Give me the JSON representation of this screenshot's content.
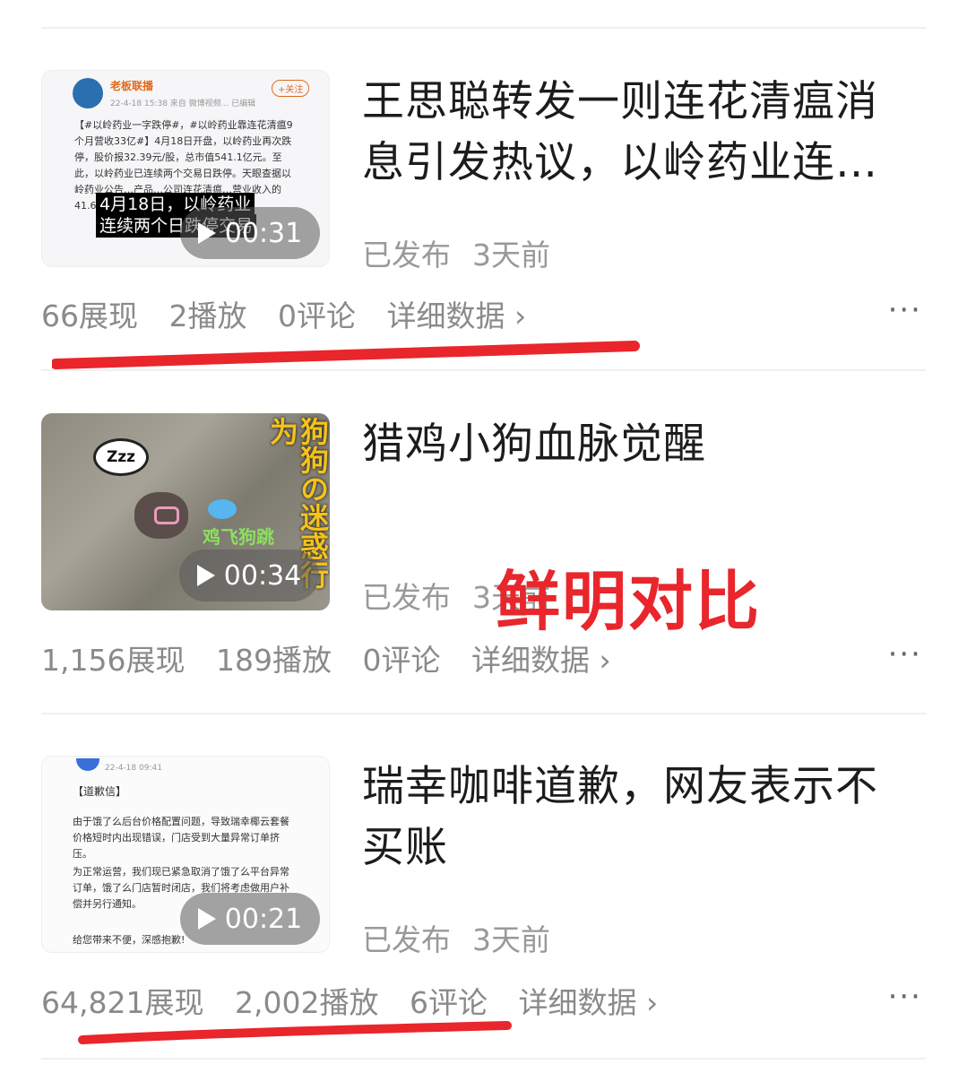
{
  "colors": {
    "accent_red": "#e8262b",
    "muted": "#999999",
    "title": "#1c1c1c"
  },
  "items": [
    {
      "title": "王思聪转发一则连花清瘟消息引发热议，以岭药业连…",
      "status": "已发布",
      "time": "3天前",
      "duration": "00:31",
      "stats": {
        "impressions": "66展现",
        "plays": "2播放",
        "comments": "0评论",
        "detail": "详细数据 ›"
      },
      "thumb": {
        "account": "老板联播",
        "follow": "+关注",
        "meta": "22-4-18 15:38  来自 微博视频... 已编辑",
        "body": "【#以岭药业一字跌停#，#以岭药业靠连花清瘟9个月营收33亿#】4月18日开盘，以岭药业再次跌停，股价报32.39元/股，总市值541.1亿元。至此，以岭药业已连续两个交易日跌停。天眼查据以岭药业公告…产品…公司连花清瘟…营业收入的41.6…",
        "caption_line1": "4月18日，以岭药业",
        "caption_line2": "连续两个日跌停交易"
      }
    },
    {
      "title": "猎鸡小狗血脉觉醒",
      "status": "已发布",
      "time": "3天前",
      "duration": "00:34",
      "stats": {
        "impressions": "1,156展现",
        "plays": "189播放",
        "comments": "0评论",
        "detail": "详细数据 ›"
      },
      "thumb": {
        "zzz": "Zzz",
        "vertical_title": "狗狗の迷惑行为",
        "overlay": "鸡飞狗跳"
      }
    },
    {
      "title": "瑞幸咖啡道歉，网友表示不买账",
      "status": "已发布",
      "time": "3天前",
      "duration": "00:21",
      "stats": {
        "impressions": "64,821展现",
        "plays": "2,002播放",
        "comments": "6评论",
        "detail": "详细数据 ›"
      },
      "thumb": {
        "meta": "22-4-18 09:41",
        "heading": "【道歉信】",
        "body1": "由于饿了么后台价格配置问题，导致瑞幸椰云套餐价格短时内出现错误，门店受到大量异常订单挤压。",
        "body2": "为正常运营，我们现已紧急取消了饿了么平台异常订单，饿了么门店暂时闭店，我们将考虑做用户补偿并另行通知。",
        "closing": "给您带来不便，深感抱歉!"
      }
    }
  ],
  "more_label": "···",
  "annotation": "鲜明对比"
}
